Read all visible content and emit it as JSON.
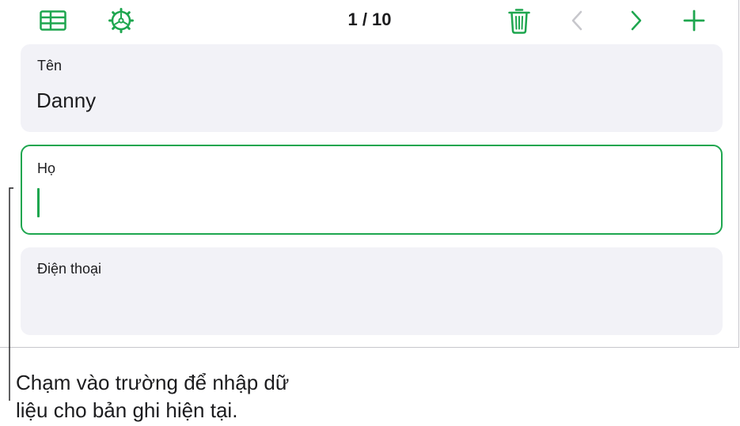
{
  "toolbar": {
    "icons": {
      "table_view": "table-icon",
      "settings": "gear-icon",
      "delete": "trash-icon",
      "previous": "chevron-left-icon",
      "next": "chevron-right-icon",
      "add": "plus-icon"
    },
    "record_counter": "1 / 10"
  },
  "fields": [
    {
      "label": "Tên",
      "value": "Danny"
    },
    {
      "label": "Họ",
      "value": ""
    },
    {
      "label": "Điện thoại",
      "value": ""
    }
  ],
  "callout": {
    "line1": "Chạm vào trường để nhập dữ",
    "line2": "liệu cho bản ghi hiện tại."
  },
  "colors": {
    "accent": "#1ea64f",
    "disabled": "#c7c7cc",
    "field_bg": "#f2f2f7"
  }
}
